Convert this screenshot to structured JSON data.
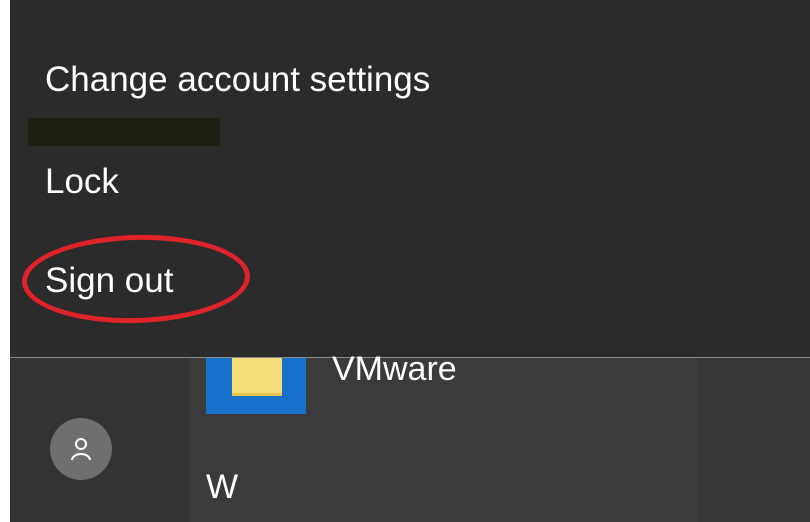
{
  "menu": {
    "items": [
      {
        "label": "Change account settings"
      },
      {
        "label": "Lock"
      },
      {
        "label": "Sign out"
      }
    ]
  },
  "start_menu": {
    "app": {
      "label": "VMware",
      "icon": "folder-icon"
    },
    "section_header": "W",
    "account_icon": "user-avatar-icon"
  },
  "colors": {
    "menu_background": "#2b2b2b",
    "highlight": "#e0232b",
    "tile_blue": "#1770c9",
    "folder_yellow": "#f7dc7a"
  }
}
